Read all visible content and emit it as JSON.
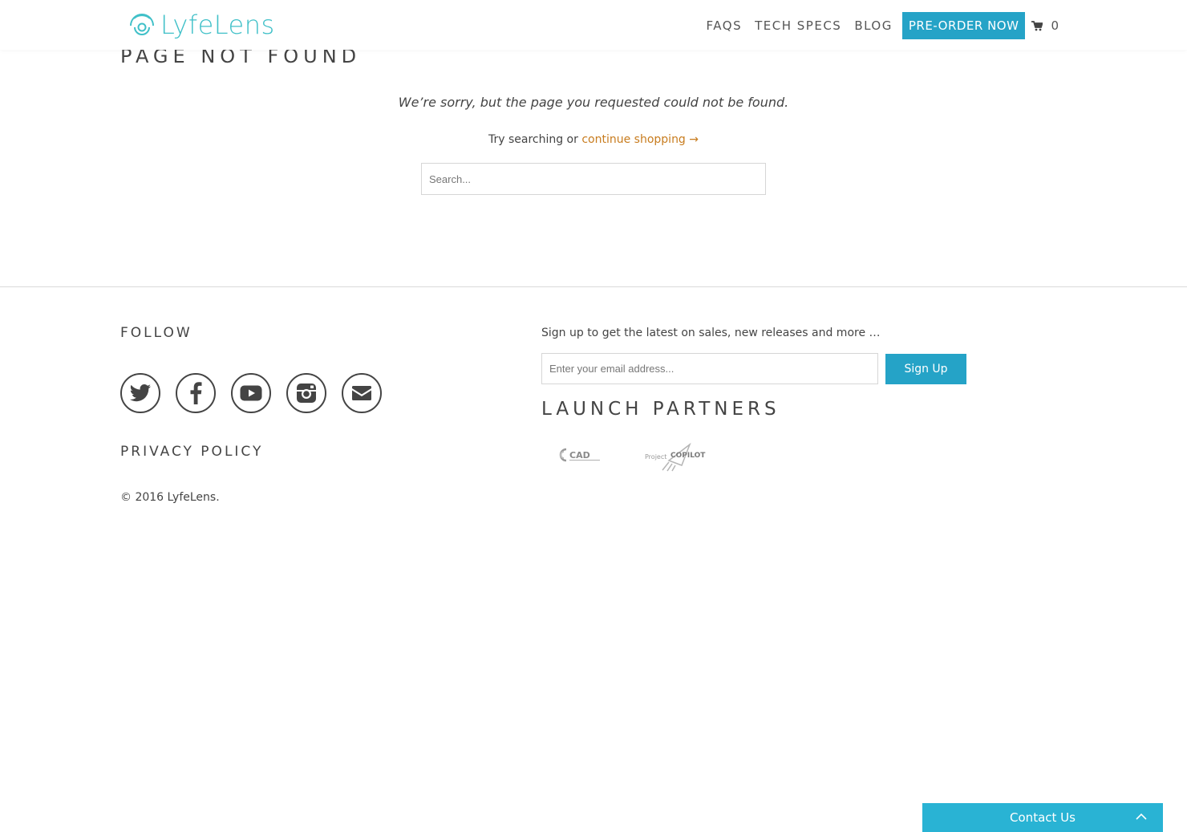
{
  "header": {
    "logo_text": "LyfeLens",
    "nav": {
      "faqs": "FAQS",
      "tech_specs": "TECH SPECS",
      "blog": "BLOG",
      "preorder": "PRE-ORDER NOW",
      "cart_count": "0"
    }
  },
  "main": {
    "title": "PAGE NOT FOUND",
    "sorry_text": "We’re sorry, but the page you requested could not be found.",
    "try_prefix": "Try searching or ",
    "continue_link": "continue shopping →",
    "search_placeholder": "Search..."
  },
  "footer": {
    "follow_title": "FOLLOW",
    "socials": [
      "twitter-icon",
      "facebook-icon",
      "youtube-icon",
      "instagram-icon",
      "email-icon"
    ],
    "privacy_link": "PRIVACY POLICY",
    "copyright": "© 2016 LyfeLens.",
    "signup_text": "Sign up to get the latest on sales, new releases and more …",
    "email_placeholder": "Enter your email address...",
    "signup_button": "Sign Up",
    "partners_title": "LAUNCH PARTNERS",
    "partners": [
      {
        "name": "CAD",
        "logo": "cad-logo"
      },
      {
        "name": "Project COPILOT",
        "logo": "copilot-logo"
      }
    ]
  },
  "contact_widget": {
    "label": "Contact Us"
  },
  "colors": {
    "accent": "#25a3c7",
    "logo": "#40c0c8",
    "link": "#c87c1e",
    "contact_bg": "#29b3d4"
  }
}
